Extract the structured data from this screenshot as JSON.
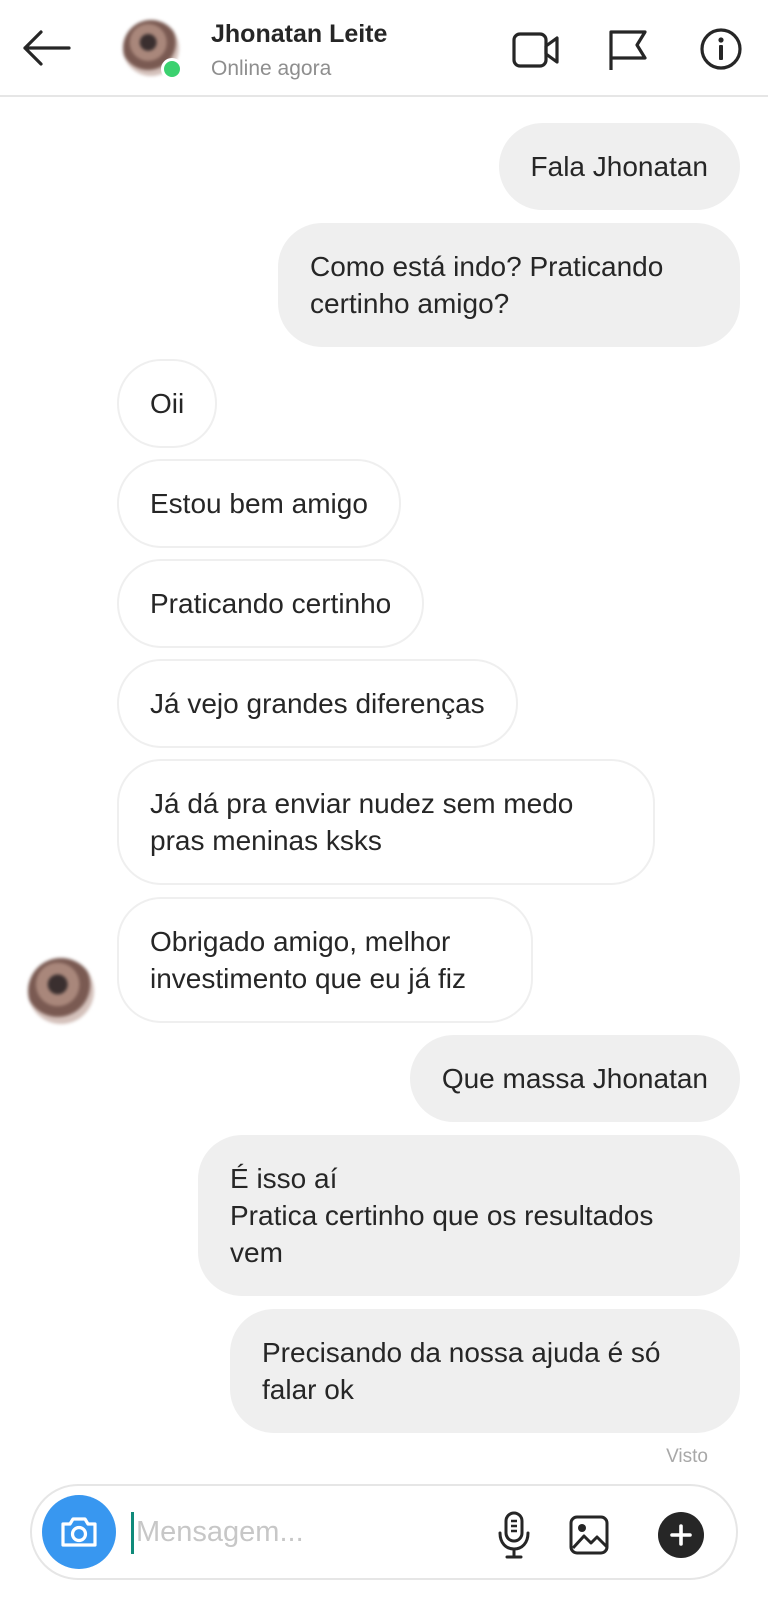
{
  "header": {
    "contact_name": "Jhonatan Leite",
    "status": "Online agora",
    "icons": [
      "back-arrow-icon",
      "video-call-icon",
      "flag-icon",
      "info-icon"
    ]
  },
  "messages": [
    {
      "direction": "outgoing",
      "text": "Fala Jhonatan"
    },
    {
      "direction": "outgoing",
      "text": "Como está indo? Praticando certinho amigo?"
    },
    {
      "direction": "incoming",
      "text": "Oii"
    },
    {
      "direction": "incoming",
      "text": "Estou bem amigo"
    },
    {
      "direction": "incoming",
      "text": "Praticando certinho"
    },
    {
      "direction": "incoming",
      "text": "Já vejo grandes diferenças"
    },
    {
      "direction": "incoming",
      "text": "Já dá pra enviar nudez sem medo pras meninas ksks"
    },
    {
      "direction": "incoming",
      "text": "Obrigado amigo, melhor investimento que eu já fiz"
    },
    {
      "direction": "outgoing",
      "text": "Que massa Jhonatan"
    },
    {
      "direction": "outgoing",
      "text": "É isso aí\nPratica certinho que os resultados vem"
    },
    {
      "direction": "outgoing",
      "text": "Precisando da nossa ajuda é só falar ok"
    }
  ],
  "seen_label": "Visto",
  "composer": {
    "placeholder": "Mensagem...",
    "value": "",
    "icons": [
      "camera-icon",
      "microphone-icon",
      "gallery-icon",
      "plus-icon"
    ]
  },
  "colors": {
    "camera_button": "#3897f0",
    "online_indicator": "#3bd16f",
    "outgoing_bubble": "#efefef",
    "incoming_bubble_border": "#efefef"
  }
}
